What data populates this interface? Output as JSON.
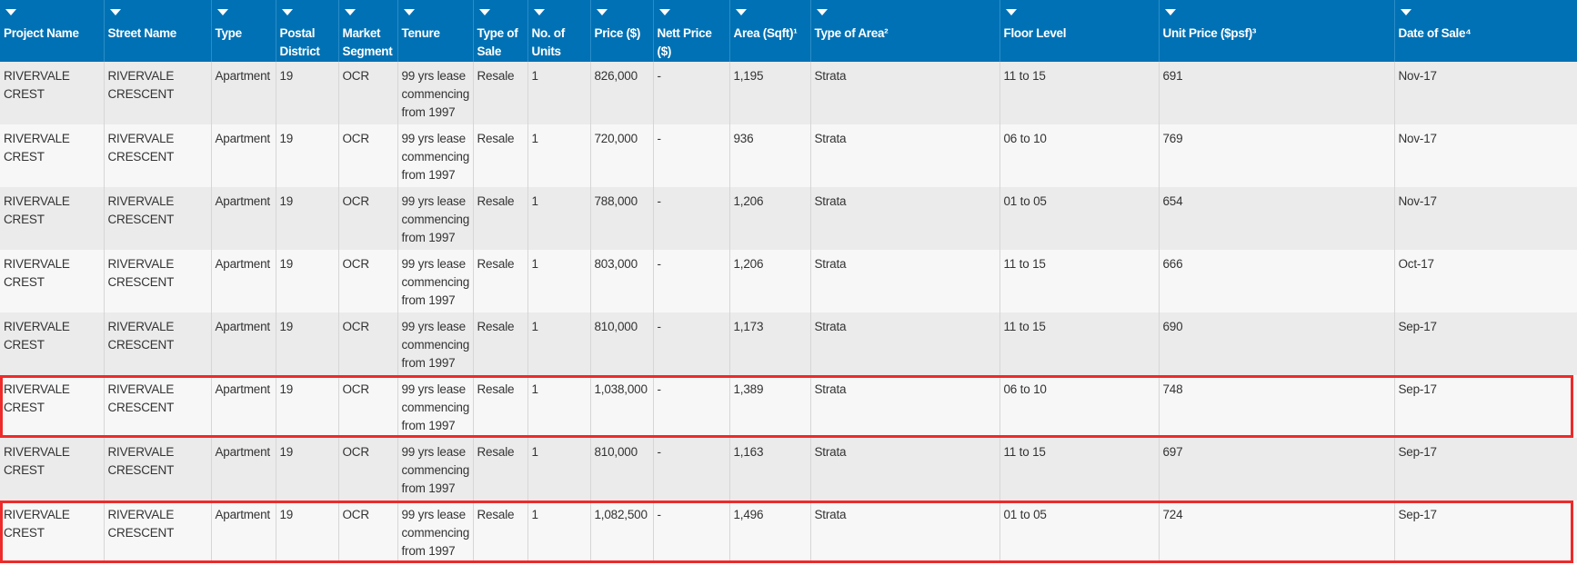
{
  "table": {
    "columns": [
      {
        "label": "Project Name"
      },
      {
        "label": "Street Name"
      },
      {
        "label": "Type"
      },
      {
        "label": "Postal District"
      },
      {
        "label": "Market Segment"
      },
      {
        "label": "Tenure"
      },
      {
        "label": "Type of Sale"
      },
      {
        "label": "No. of Units"
      },
      {
        "label": "Price ($)"
      },
      {
        "label": "Nett Price ($)"
      },
      {
        "label": "Area (Sqft)¹"
      },
      {
        "label": "Type of Area²"
      },
      {
        "label": "Floor Level"
      },
      {
        "label": "Unit Price ($psf)³"
      },
      {
        "label": "Date of Sale⁴"
      }
    ],
    "rows": [
      {
        "highlighted": false,
        "cells": [
          "RIVERVALE CREST",
          "RIVERVALE CRESCENT",
          "Apartment",
          "19",
          "OCR",
          "99 yrs lease commencing from 1997",
          "Resale",
          "1",
          "826,000",
          "-",
          "1,195",
          "Strata",
          "11 to 15",
          "691",
          "Nov-17"
        ]
      },
      {
        "highlighted": false,
        "cells": [
          "RIVERVALE CREST",
          "RIVERVALE CRESCENT",
          "Apartment",
          "19",
          "OCR",
          "99 yrs lease commencing from 1997",
          "Resale",
          "1",
          "720,000",
          "-",
          "936",
          "Strata",
          "06 to 10",
          "769",
          "Nov-17"
        ]
      },
      {
        "highlighted": false,
        "cells": [
          "RIVERVALE CREST",
          "RIVERVALE CRESCENT",
          "Apartment",
          "19",
          "OCR",
          "99 yrs lease commencing from 1997",
          "Resale",
          "1",
          "788,000",
          "-",
          "1,206",
          "Strata",
          "01 to 05",
          "654",
          "Nov-17"
        ]
      },
      {
        "highlighted": false,
        "cells": [
          "RIVERVALE CREST",
          "RIVERVALE CRESCENT",
          "Apartment",
          "19",
          "OCR",
          "99 yrs lease commencing from 1997",
          "Resale",
          "1",
          "803,000",
          "-",
          "1,206",
          "Strata",
          "11 to 15",
          "666",
          "Oct-17"
        ]
      },
      {
        "highlighted": false,
        "cells": [
          "RIVERVALE CREST",
          "RIVERVALE CRESCENT",
          "Apartment",
          "19",
          "OCR",
          "99 yrs lease commencing from 1997",
          "Resale",
          "1",
          "810,000",
          "-",
          "1,173",
          "Strata",
          "11 to 15",
          "690",
          "Sep-17"
        ]
      },
      {
        "highlighted": true,
        "cells": [
          "RIVERVALE CREST",
          "RIVERVALE CRESCENT",
          "Apartment",
          "19",
          "OCR",
          "99 yrs lease commencing from 1997",
          "Resale",
          "1",
          "1,038,000",
          "-",
          "1,389",
          "Strata",
          "06 to 10",
          "748",
          "Sep-17"
        ]
      },
      {
        "highlighted": false,
        "cells": [
          "RIVERVALE CREST",
          "RIVERVALE CRESCENT",
          "Apartment",
          "19",
          "OCR",
          "99 yrs lease commencing from 1997",
          "Resale",
          "1",
          "810,000",
          "-",
          "1,163",
          "Strata",
          "11 to 15",
          "697",
          "Sep-17"
        ]
      },
      {
        "highlighted": true,
        "cells": [
          "RIVERVALE CREST",
          "RIVERVALE CRESCENT",
          "Apartment",
          "19",
          "OCR",
          "99 yrs lease commencing from 1997",
          "Resale",
          "1",
          "1,082,500",
          "-",
          "1,496",
          "Strata",
          "01 to 05",
          "724",
          "Sep-17"
        ]
      }
    ]
  },
  "colors": {
    "header_bg": "#0071b4",
    "row_odd": "#ebebeb",
    "row_even": "#f7f7f7",
    "highlight_box": "#ee2a2a"
  },
  "icons": {
    "sort": "caret-down-icon"
  }
}
